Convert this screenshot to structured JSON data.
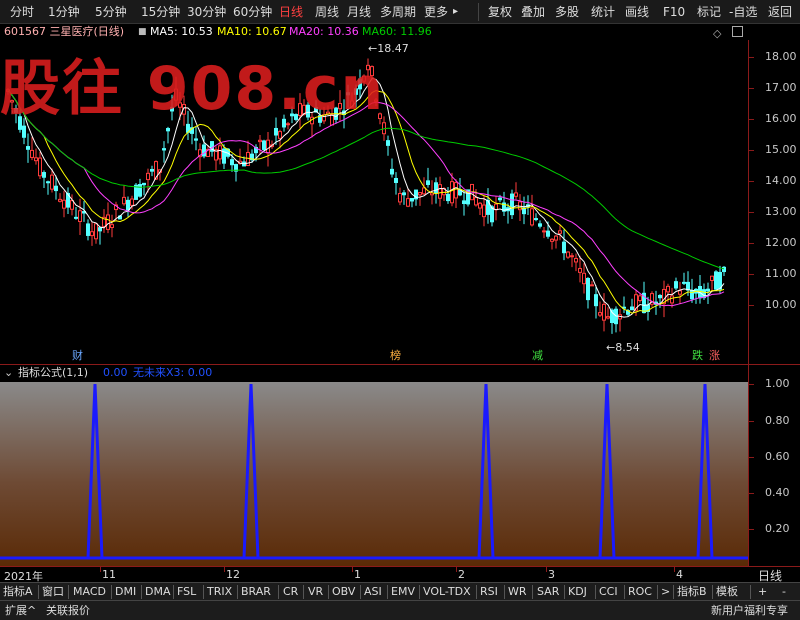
{
  "toolbar": {
    "left_items": [
      "分时",
      "1分钟",
      "5分钟",
      "15分钟",
      "30分钟",
      "60分钟",
      "日线",
      "周线",
      "月线",
      "多周期",
      "更多"
    ],
    "active": "日线",
    "right_items": [
      "复权",
      "叠加",
      "多股",
      "统计",
      "画线",
      "F10",
      "标记",
      "-自选",
      "返回"
    ]
  },
  "header": {
    "code_name": "601567 三星医疗(日线)",
    "ma5": "MA5: 10.53",
    "ma10": "MA10: 10.67",
    "ma20": "MA20: 10.36",
    "ma60": "MA60: 11.96",
    "diamond_icon": "diamond-icon",
    "collapse_icon": "panel-icon"
  },
  "watermark": "股往 908.cn",
  "colors": {
    "up": "#ff3c3c",
    "down": "#54ffff",
    "ma5": "#ffffff",
    "ma10": "#ffff00",
    "ma20": "#ff40ff",
    "ma60": "#00cc00",
    "signal": "#1a1aff",
    "frame": "#8b1a1a"
  },
  "main_chart": {
    "y_ticks": [
      "18.00",
      "17.00",
      "16.00",
      "15.00",
      "14.00",
      "13.00",
      "12.00",
      "11.00",
      "10.00"
    ],
    "high_label": "18.47",
    "low_label": "8.54",
    "markers": [
      {
        "text": "财",
        "color": "#6aa7ff"
      },
      {
        "text": "榜",
        "color": "#ffb040"
      },
      {
        "text": "减",
        "color": "#40e040"
      },
      {
        "text": "跌",
        "color": "#40e040"
      },
      {
        "text": "涨",
        "color": "#ff6060"
      }
    ]
  },
  "indicator": {
    "title": "指标公式(1,1)",
    "value": "0.00",
    "series_label": "无未来X3: 0.00",
    "y_ticks": [
      "1.00",
      "0.80",
      "0.60",
      "0.40",
      "0.20"
    ]
  },
  "chart_data": {
    "type": "line",
    "title": "",
    "xlabel": "",
    "ylabel": "",
    "x_labels": [
      "2021年",
      "11",
      "12",
      "1",
      "2",
      "3",
      "4"
    ],
    "ylim": [
      0,
      1
    ],
    "series": [
      {
        "name": "无未来X3",
        "spikes": [
          1,
          1,
          1,
          1,
          1
        ],
        "baseline": 0
      }
    ]
  },
  "time_axis": {
    "labels": [
      "2021年",
      "11",
      "12",
      "1",
      "2",
      "3",
      "4"
    ],
    "period_label": "日线"
  },
  "tabs": [
    "指标A",
    "窗口",
    "MACD",
    "DMI",
    "DMA",
    "FSL",
    "TRIX",
    "BRAR",
    "CR",
    "VR",
    "OBV",
    "ASI",
    "EMV",
    "VOL-TDX",
    "RSI",
    "WR",
    "SAR",
    "KDJ",
    "CCI",
    "ROC",
    ">",
    "指标B",
    "模板",
    "+",
    "-"
  ],
  "status": {
    "left": [
      "扩展^",
      "关联报价"
    ],
    "right": "新用户福利专享"
  }
}
